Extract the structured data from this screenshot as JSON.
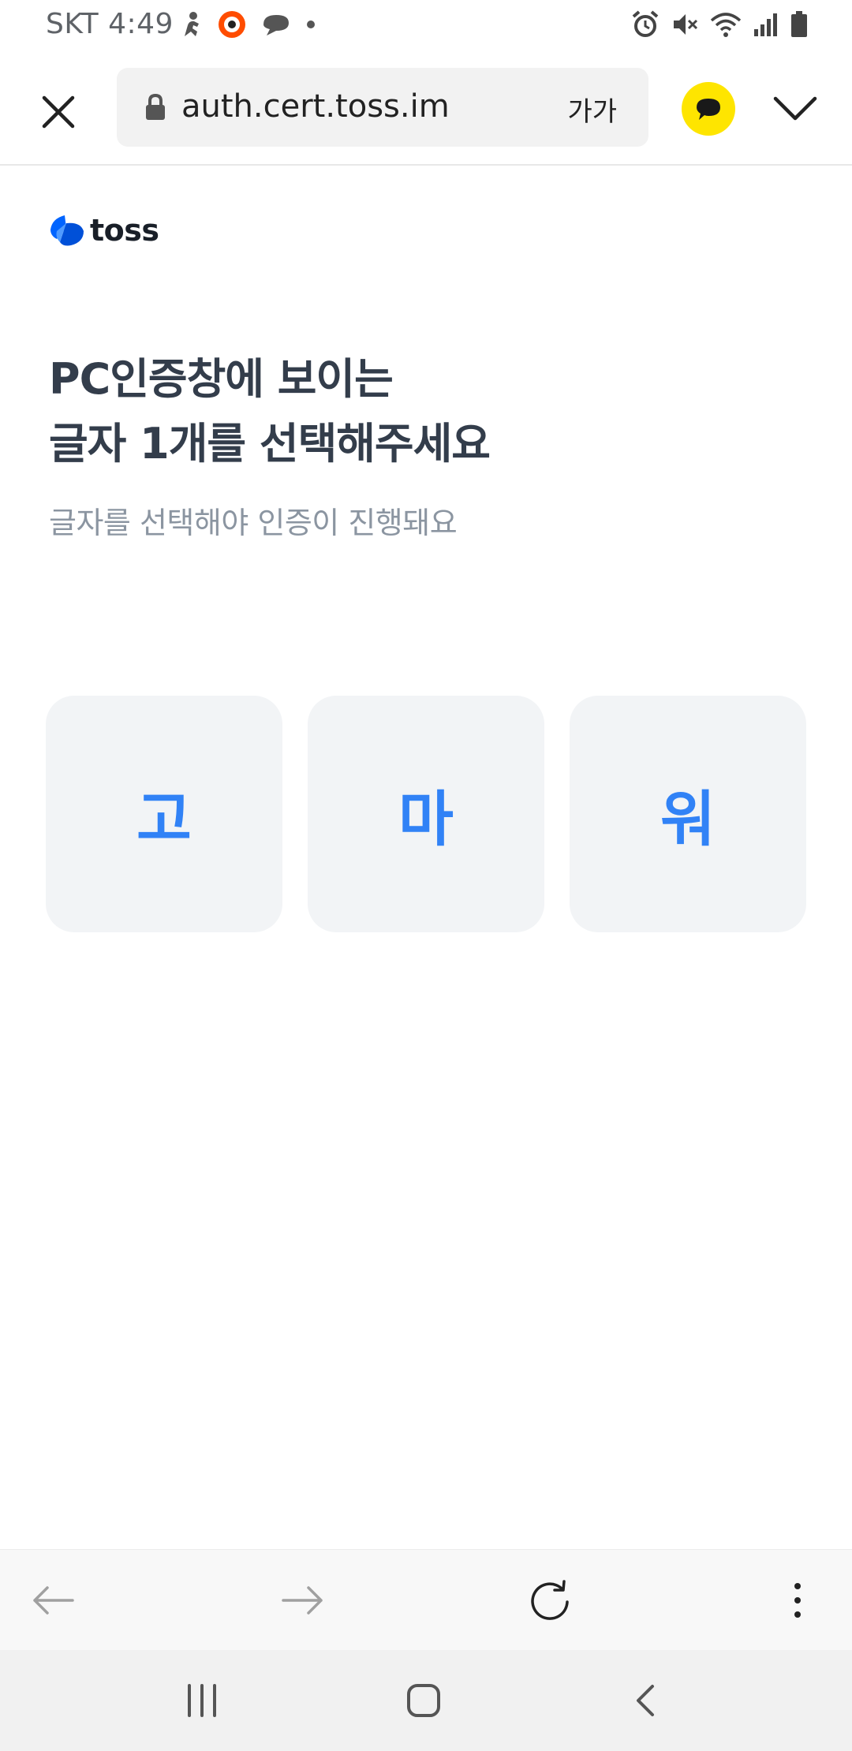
{
  "status_bar": {
    "carrier_time": "SKT 4:49",
    "icons": [
      "figure-icon",
      "record-icon",
      "chat-bubble-icon",
      "dot-icon",
      "alarm-icon",
      "mute-icon",
      "wifi-icon",
      "signal-icon",
      "battery-icon"
    ]
  },
  "browser": {
    "url": "auth.cert.toss.im",
    "text_size_label": "가가",
    "talk_color": "#fee500"
  },
  "page": {
    "logo_text": "toss",
    "title_line1": "PC인증창에 보이는",
    "title_line2": "글자 1개를 선택해주세요",
    "subtitle": "글자를 선택해야 인증이 진행돼요",
    "choices": [
      "고",
      "마",
      "워"
    ],
    "accent_color": "#3182f6"
  },
  "toolbar": {
    "icons": [
      "back-arrow-icon",
      "forward-arrow-icon",
      "reload-icon",
      "more-icon"
    ]
  },
  "nav": {
    "icons": [
      "recent-apps-icon",
      "home-icon",
      "back-icon"
    ]
  }
}
